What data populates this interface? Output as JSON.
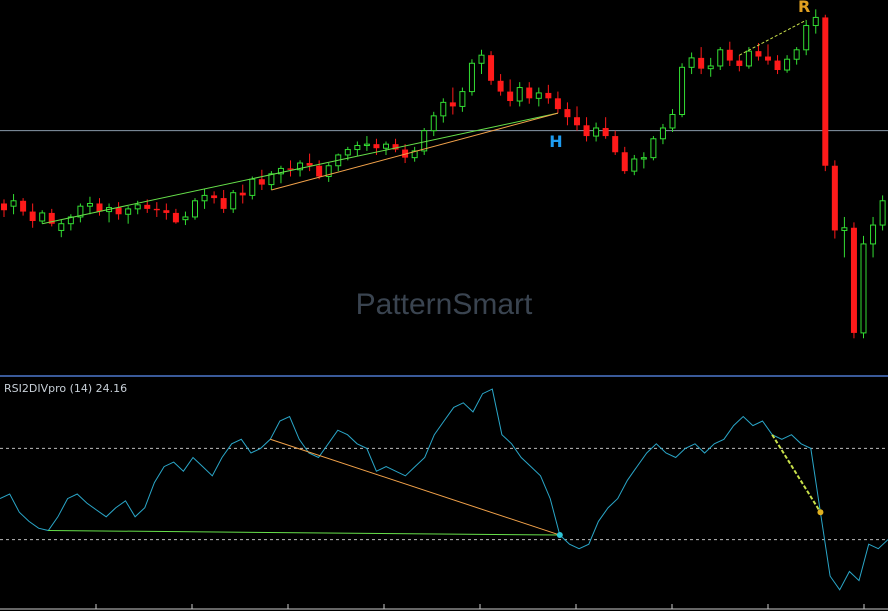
{
  "watermark": "PatternSmart",
  "indicator_label": "RSI2DIVpro (14) 24.16",
  "colors": {
    "bg": "#000000",
    "bull": "#33dd33",
    "bear": "#ff1a1a",
    "hline": "#8899aa",
    "rsi_line": "#2aa6c8",
    "div_bull": "#66e04a",
    "div_hidden": "#f2a24a",
    "div_bear_line": "#c8e04a",
    "h_label": "#1e9cf0",
    "r_label": "#e0a020",
    "rsi_dot_bull": "#2ec4d6",
    "rsi_dot_bear": "#e0b020",
    "level_line": "#bbbbbb",
    "separator": "#3a5a9a"
  },
  "markers": [
    {
      "text": "H",
      "bar": 58
    },
    {
      "text": "R",
      "bar": 84
    }
  ],
  "chart_data": [
    {
      "type": "candlestick",
      "title": "",
      "horizontal_level": 0.244,
      "ylim": [
        0.065,
        0.335
      ],
      "bars": [
        [
          0.19,
          0.193,
          0.18,
          0.185
        ],
        [
          0.188,
          0.197,
          0.182,
          0.192
        ],
        [
          0.192,
          0.194,
          0.181,
          0.184
        ],
        [
          0.184,
          0.19,
          0.172,
          0.177
        ],
        [
          0.177,
          0.185,
          0.175,
          0.183
        ],
        [
          0.183,
          0.186,
          0.173,
          0.175
        ],
        [
          0.17,
          0.178,
          0.165,
          0.175
        ],
        [
          0.175,
          0.182,
          0.17,
          0.18
        ],
        [
          0.18,
          0.19,
          0.176,
          0.188
        ],
        [
          0.188,
          0.195,
          0.182,
          0.19
        ],
        [
          0.19,
          0.194,
          0.181,
          0.184
        ],
        [
          0.184,
          0.19,
          0.176,
          0.187
        ],
        [
          0.187,
          0.191,
          0.178,
          0.182
        ],
        [
          0.182,
          0.188,
          0.175,
          0.186
        ],
        [
          0.186,
          0.192,
          0.182,
          0.189
        ],
        [
          0.189,
          0.193,
          0.183,
          0.186
        ],
        [
          0.186,
          0.191,
          0.18,
          0.185
        ],
        [
          0.185,
          0.19,
          0.178,
          0.183
        ],
        [
          0.183,
          0.186,
          0.175,
          0.176
        ],
        [
          0.178,
          0.184,
          0.174,
          0.18
        ],
        [
          0.18,
          0.194,
          0.178,
          0.192
        ],
        [
          0.192,
          0.201,
          0.186,
          0.196
        ],
        [
          0.196,
          0.199,
          0.19,
          0.194
        ],
        [
          0.194,
          0.2,
          0.183,
          0.186
        ],
        [
          0.186,
          0.2,
          0.183,
          0.198
        ],
        [
          0.198,
          0.204,
          0.19,
          0.196
        ],
        [
          0.196,
          0.21,
          0.193,
          0.208
        ],
        [
          0.208,
          0.215,
          0.2,
          0.204
        ],
        [
          0.204,
          0.214,
          0.2,
          0.212
        ],
        [
          0.212,
          0.218,
          0.205,
          0.216
        ],
        [
          0.216,
          0.222,
          0.21,
          0.215
        ],
        [
          0.215,
          0.222,
          0.21,
          0.22
        ],
        [
          0.22,
          0.227,
          0.214,
          0.218
        ],
        [
          0.218,
          0.222,
          0.208,
          0.21
        ],
        [
          0.21,
          0.22,
          0.206,
          0.218
        ],
        [
          0.218,
          0.227,
          0.214,
          0.226
        ],
        [
          0.226,
          0.232,
          0.222,
          0.23
        ],
        [
          0.23,
          0.236,
          0.225,
          0.233
        ],
        [
          0.233,
          0.24,
          0.229,
          0.234
        ],
        [
          0.234,
          0.238,
          0.226,
          0.231
        ],
        [
          0.231,
          0.236,
          0.226,
          0.234
        ],
        [
          0.234,
          0.238,
          0.228,
          0.23
        ],
        [
          0.23,
          0.234,
          0.22,
          0.224
        ],
        [
          0.224,
          0.232,
          0.221,
          0.229
        ],
        [
          0.229,
          0.246,
          0.226,
          0.244
        ],
        [
          0.244,
          0.258,
          0.24,
          0.255
        ],
        [
          0.255,
          0.268,
          0.25,
          0.265
        ],
        [
          0.265,
          0.276,
          0.256,
          0.262
        ],
        [
          0.262,
          0.276,
          0.258,
          0.273
        ],
        [
          0.273,
          0.297,
          0.27,
          0.294
        ],
        [
          0.294,
          0.304,
          0.286,
          0.3
        ],
        [
          0.3,
          0.303,
          0.278,
          0.281
        ],
        [
          0.281,
          0.286,
          0.27,
          0.273
        ],
        [
          0.273,
          0.282,
          0.262,
          0.266
        ],
        [
          0.266,
          0.28,
          0.262,
          0.276
        ],
        [
          0.276,
          0.28,
          0.264,
          0.268
        ],
        [
          0.268,
          0.276,
          0.262,
          0.272
        ],
        [
          0.272,
          0.278,
          0.264,
          0.268
        ],
        [
          0.268,
          0.273,
          0.257,
          0.26
        ],
        [
          0.26,
          0.265,
          0.248,
          0.254
        ],
        [
          0.254,
          0.262,
          0.244,
          0.248
        ],
        [
          0.248,
          0.254,
          0.236,
          0.24
        ],
        [
          0.24,
          0.25,
          0.236,
          0.246
        ],
        [
          0.246,
          0.254,
          0.238,
          0.24
        ],
        [
          0.24,
          0.244,
          0.226,
          0.228
        ],
        [
          0.228,
          0.232,
          0.212,
          0.214
        ],
        [
          0.214,
          0.226,
          0.211,
          0.223
        ],
        [
          0.223,
          0.228,
          0.216,
          0.224
        ],
        [
          0.224,
          0.24,
          0.222,
          0.238
        ],
        [
          0.238,
          0.249,
          0.234,
          0.246
        ],
        [
          0.246,
          0.26,
          0.243,
          0.256
        ],
        [
          0.256,
          0.294,
          0.254,
          0.291
        ],
        [
          0.291,
          0.302,
          0.286,
          0.298
        ],
        [
          0.298,
          0.306,
          0.286,
          0.29
        ],
        [
          0.29,
          0.298,
          0.284,
          0.292
        ],
        [
          0.292,
          0.306,
          0.289,
          0.304
        ],
        [
          0.304,
          0.31,
          0.292,
          0.296
        ],
        [
          0.296,
          0.3,
          0.288,
          0.292
        ],
        [
          0.292,
          0.306,
          0.29,
          0.303
        ],
        [
          0.303,
          0.309,
          0.296,
          0.299
        ],
        [
          0.299,
          0.308,
          0.293,
          0.296
        ],
        [
          0.296,
          0.3,
          0.286,
          0.289
        ],
        [
          0.289,
          0.3,
          0.287,
          0.297
        ],
        [
          0.297,
          0.306,
          0.293,
          0.304
        ],
        [
          0.304,
          0.326,
          0.3,
          0.322
        ],
        [
          0.322,
          0.334,
          0.316,
          0.328
        ]
      ],
      "after_peak_bars": [
        [
          0.328,
          0.33,
          0.214,
          0.218
        ],
        [
          0.218,
          0.222,
          0.164,
          0.17
        ],
        [
          0.17,
          0.18,
          0.15,
          0.172
        ],
        [
          0.172,
          0.176,
          0.09,
          0.094
        ],
        [
          0.094,
          0.166,
          0.09,
          0.16
        ],
        [
          0.16,
          0.18,
          0.15,
          0.174
        ],
        [
          0.174,
          0.196,
          0.17,
          0.192
        ],
        [
          0.192,
          0.2,
          0.176,
          0.184
        ],
        [
          0.184,
          0.198,
          0.18,
          0.194
        ]
      ]
    },
    {
      "type": "line",
      "title": "RSI2DIVpro (14) 24.16",
      "ylim": [
        0,
        100
      ],
      "levels": [
        70,
        30
      ],
      "values": [
        48,
        50,
        42,
        38,
        35,
        34,
        40,
        48,
        50,
        46,
        43,
        40,
        44,
        47,
        40,
        44,
        55,
        62,
        64,
        60,
        66,
        62,
        58,
        66,
        72,
        74,
        68,
        70,
        74,
        82,
        84,
        74,
        68,
        66,
        72,
        78,
        76,
        72,
        70,
        60,
        62,
        60,
        58,
        62,
        66,
        76,
        82,
        88,
        90,
        86,
        94,
        96,
        76,
        72,
        66,
        62,
        58,
        48,
        32,
        28,
        26,
        28,
        38,
        44,
        48,
        56,
        62,
        68,
        72,
        68,
        66,
        70,
        72,
        68,
        72,
        74,
        80,
        84,
        80,
        82,
        76,
        74,
        76,
        72,
        70,
        42,
        14,
        8,
        16,
        12,
        28,
        26,
        30
      ]
    }
  ]
}
